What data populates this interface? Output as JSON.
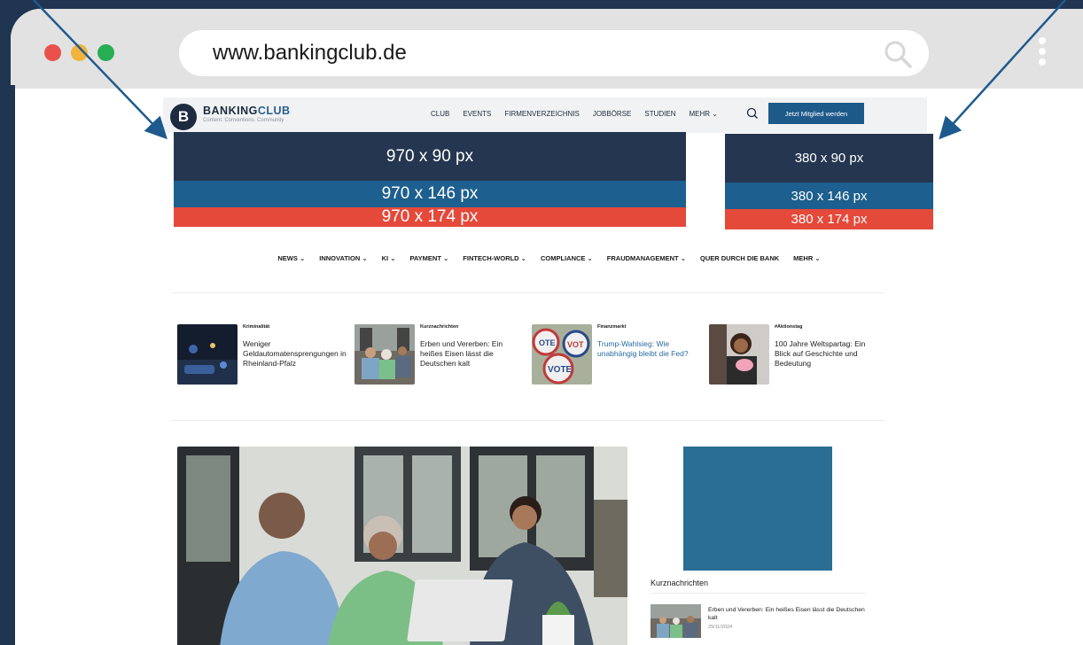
{
  "browser": {
    "url": "www.bankingclub.de",
    "dot_colors": [
      "#e8524a",
      "#f2b33d",
      "#27ae55"
    ]
  },
  "header": {
    "logo_letter": "B",
    "logo_name_part1": "BANKING",
    "logo_name_part2": "CLUB",
    "logo_tagline": "Content. Conventions. Community",
    "nav": [
      "CLUB",
      "EVENTS",
      "FIRMENVERZEICHNIS",
      "JOBBÖRSE",
      "STUDIEN",
      "MEHR ⌄"
    ],
    "cta_label": "Jetzt Mitglied werden"
  },
  "ads": {
    "left": [
      "970 x 90 px",
      "970 x 146 px",
      "970 x 174 px"
    ],
    "right": [
      "380 x 90 px",
      "380 x 146 px",
      "380 x 174 px"
    ],
    "colors": [
      "#253650",
      "#1d5f8e",
      "#e5493a"
    ]
  },
  "category_nav": [
    "NEWS ⌄",
    "INNOVATION ⌄",
    "KI ⌄",
    "PAYMENT ⌄",
    "FINTECH-WORLD ⌄",
    "COMPLIANCE ⌄",
    "FRAUDMANAGEMENT ⌄",
    "QUER DURCH DIE BANK",
    "MEHR ⌄"
  ],
  "teasers": [
    {
      "category": "Kriminalität",
      "title": "Weniger Geldautomatensprengungen in Rheinland-Pfalz"
    },
    {
      "category": "Kurznachrichten",
      "title": "Erben und Vererben: Ein heißes Eisen lässt die Deutschen kalt"
    },
    {
      "category": "Finanzmarkt",
      "title": "Trump-Wahlsieg: Wie unabhängig bleibt die Fed?"
    },
    {
      "category": "#Aktionstag",
      "title": "100 Jahre Weltspartag: Ein Blick auf Geschichte und Bedeutung"
    }
  ],
  "sidebar": {
    "section_label": "Kurznachrichten",
    "item_title": "Erben und Vererben: Ein heißes Eisen lässt die Deutschen kalt",
    "item_date": "29/11/2024"
  }
}
